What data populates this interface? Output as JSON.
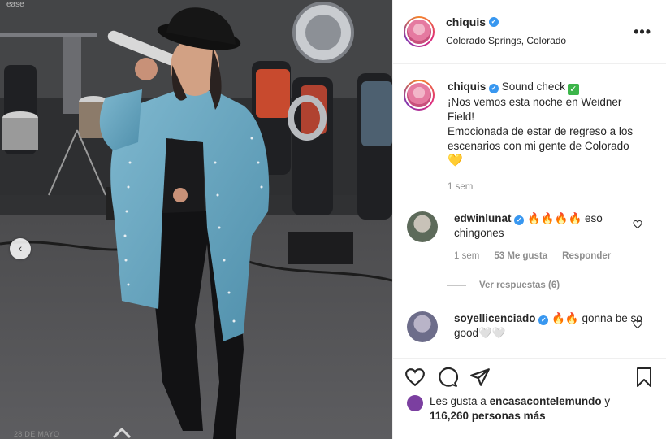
{
  "photo": {
    "caption": "ease"
  },
  "header": {
    "username": "chiquis",
    "location": "Colorado Springs, Colorado",
    "more": "•••"
  },
  "caption": {
    "username": "chiquis",
    "first_line": "Sound check",
    "lines": [
      "¡Nos vemos esta noche en Weidner Field!",
      "Emocionada de estar de regreso a los escenarios con mi gente de Colorado"
    ],
    "emoji_end": "💛",
    "time": "1 sem"
  },
  "comments": [
    {
      "username": "edwinlunat",
      "emoji": "🔥🔥🔥🔥",
      "text": " eso chingones",
      "time": "1 sem",
      "likes": "53 Me gusta",
      "reply": "Responder",
      "view_replies": "Ver respuestas (6)"
    },
    {
      "username": "soyellicenciado",
      "emoji": "🔥🔥",
      "text": " gonna be so good",
      "tail": "🤍🤍"
    }
  ],
  "likes": {
    "prefix": "Les gusta a",
    "user": "encasacontelemundo",
    "conj": "y",
    "count": "116,260 personas más"
  },
  "date": "28 DE MAYO",
  "colors": {
    "verified": "#3897f0",
    "accent": "#262626",
    "muted": "#8e8e8e"
  }
}
